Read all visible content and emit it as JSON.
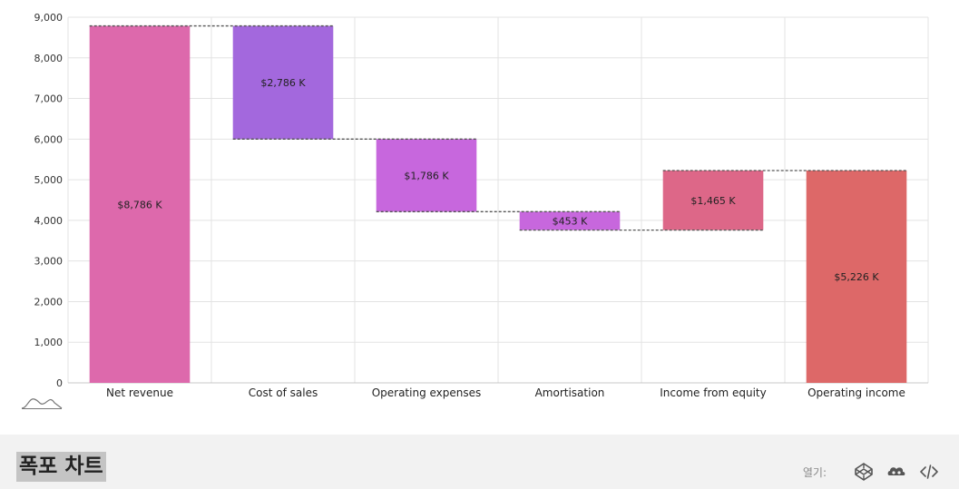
{
  "chart_data": {
    "type": "waterfall",
    "categories": [
      "Net revenue",
      "Cost of sales",
      "Operating expenses",
      "Amortisation",
      "Income from equity",
      "Operating income"
    ],
    "steps": [
      {
        "label": "Net revenue",
        "kind": "total",
        "start": 0,
        "end": 8786,
        "data_label": "$8,786 K",
        "color": "#dd69ac"
      },
      {
        "label": "Cost of sales",
        "kind": "decrease",
        "start": 8786,
        "end": 6000,
        "data_label": "$2,786 K",
        "color": "#a368dd"
      },
      {
        "label": "Operating expenses",
        "kind": "decrease",
        "start": 6000,
        "end": 4214,
        "data_label": "$1,786 K",
        "color": "#c767dd"
      },
      {
        "label": "Amortisation",
        "kind": "decrease",
        "start": 4214,
        "end": 3761,
        "data_label": "$453 K",
        "color": "#c767dd"
      },
      {
        "label": "Income from equity",
        "kind": "increase",
        "start": 3761,
        "end": 5226,
        "data_label": "$1,465 K",
        "color": "#dd6788"
      },
      {
        "label": "Operating income",
        "kind": "total",
        "start": 0,
        "end": 5226,
        "data_label": "$5,226 K",
        "color": "#dd6868"
      }
    ],
    "yticks": [
      "0",
      "1,000",
      "2,000",
      "3,000",
      "4,000",
      "5,000",
      "6,000",
      "7,000",
      "8,000",
      "9,000"
    ],
    "ylim": [
      0,
      9000
    ],
    "grid": true
  },
  "footer": {
    "title": "폭포 차트",
    "open_label": "열기:"
  },
  "icons": {
    "logo": "amcharts-logo-icon",
    "codepen": "codepen-icon",
    "codesandbox": "codesandbox-icon",
    "code": "code-icon"
  }
}
